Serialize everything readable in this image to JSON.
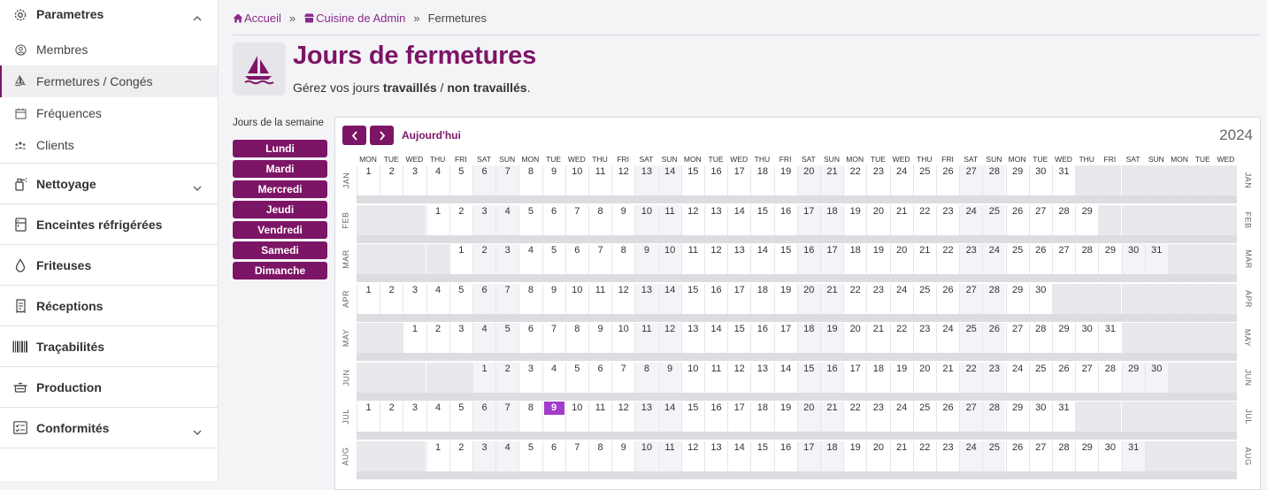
{
  "sidebar": {
    "parametres": {
      "label": "Parametres",
      "items": [
        {
          "label": "Membres",
          "icon": "user-circle-icon"
        },
        {
          "label": "Fermetures / Congés",
          "icon": "sailboat-icon",
          "active": true
        },
        {
          "label": "Fréquences",
          "icon": "calendar-icon"
        },
        {
          "label": "Clients",
          "icon": "users-icon"
        }
      ]
    },
    "sections": [
      {
        "label": "Nettoyage",
        "icon": "spray-icon",
        "chevron": true
      },
      {
        "label": "Enceintes réfrigérées",
        "icon": "fridge-icon",
        "chevron": false
      },
      {
        "label": "Friteuses",
        "icon": "drop-icon",
        "chevron": false
      },
      {
        "label": "Réceptions",
        "icon": "receipt-icon",
        "chevron": false
      },
      {
        "label": "Traçabilités",
        "icon": "barcode-icon",
        "chevron": false
      },
      {
        "label": "Production",
        "icon": "cooking-pot-icon",
        "chevron": false
      },
      {
        "label": "Conformités",
        "icon": "checklist-icon",
        "chevron": true
      }
    ]
  },
  "breadcrumb": {
    "home": "Accueil",
    "sep1": "»",
    "kitchen": "Cuisine de Admin",
    "sep2": "»",
    "current": "Fermetures"
  },
  "page": {
    "title": "Jours de fermetures",
    "subtitle_prefix": "Gérez vos jours ",
    "subtitle_bold1": "travaillés",
    "subtitle_mid": " / ",
    "subtitle_bold2": "non travaillés",
    "subtitle_suffix": "."
  },
  "weekdays": {
    "title": "Jours de la semaine",
    "days": [
      "Lundi",
      "Mardi",
      "Mercredi",
      "Jeudi",
      "Vendredi",
      "Samedi",
      "Dimanche"
    ]
  },
  "calendar": {
    "prev_label": "previous",
    "next_label": "next",
    "today_label": "Aujourd'hui",
    "year": "2024",
    "day_headers": [
      "MON",
      "TUE",
      "WED",
      "THU",
      "FRI",
      "SAT",
      "SUN",
      "MON",
      "TUE",
      "WED",
      "THU",
      "FRI",
      "SAT",
      "SUN",
      "MON",
      "TUE",
      "WED",
      "THU",
      "FRI",
      "SAT",
      "SUN",
      "MON",
      "TUE",
      "WED",
      "THU",
      "FRI",
      "SAT",
      "SUN",
      "MON",
      "TUE",
      "WED",
      "THU",
      "FRI",
      "SAT",
      "SUN",
      "MON",
      "TUE",
      "WED"
    ],
    "today": {
      "month": 6,
      "day": 9
    },
    "months": [
      {
        "label": "JAN",
        "offset": 0,
        "days": 31
      },
      {
        "label": "FEB",
        "offset": 3,
        "days": 29
      },
      {
        "label": "MAR",
        "offset": 4,
        "days": 31
      },
      {
        "label": "APR",
        "offset": 0,
        "days": 30
      },
      {
        "label": "MAY",
        "offset": 2,
        "days": 31
      },
      {
        "label": "JUN",
        "offset": 5,
        "days": 30
      },
      {
        "label": "JUL",
        "offset": 0,
        "days": 31
      },
      {
        "label": "AUG",
        "offset": 3,
        "days": 31
      }
    ]
  },
  "colors": {
    "accent": "#7d1566",
    "link": "#8a2a8a",
    "today": "#a43ccc"
  }
}
